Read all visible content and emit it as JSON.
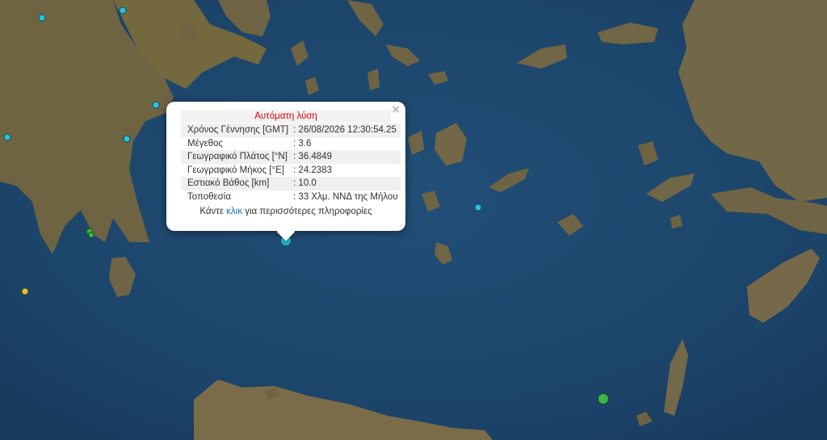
{
  "popup": {
    "title": "Αυτόματη λύση",
    "close_icon": "×",
    "rows": [
      {
        "label": "Χρόνος Γέννησης [GMT]",
        "value": ": 26/08/2026 12:30:54.25"
      },
      {
        "label": "Μέγεθος",
        "value": ": 3.6"
      },
      {
        "label": "Γεωγραφικό Πλάτος [°N]",
        "value": ": 36.4849"
      },
      {
        "label": "Γεωγραφικό Μήκος [°E]",
        "value": ": 24.2383"
      },
      {
        "label": "Εστιακό Βάθος [km]",
        "value": ": 10.0"
      },
      {
        "label": "Τοποθεσία",
        "value": ": 33 Χλμ. ΝΝΔ της Μήλου"
      }
    ],
    "more_prefix": "Κάντε",
    "more_link": "κλικ",
    "more_suffix": "για περισσότερες πληροφορίες"
  },
  "markers": [
    {
      "name": "selected-quake-marker",
      "color": "#29b6d6",
      "size": "large"
    },
    {
      "name": "quake-marker-cyan",
      "color": "#29c4dc",
      "size": "small"
    },
    {
      "name": "quake-marker-green",
      "color": "#3cb44b",
      "size": "small"
    },
    {
      "name": "quake-marker-yellow",
      "color": "#e6c229",
      "size": "small"
    },
    {
      "name": "quake-marker-green-large",
      "color": "#3cb44b",
      "size": "large"
    }
  ],
  "colors": {
    "sea": "#1f4d73",
    "land": "#7a6a45",
    "accent_red": "#e00000",
    "link": "#1a6fc4"
  }
}
